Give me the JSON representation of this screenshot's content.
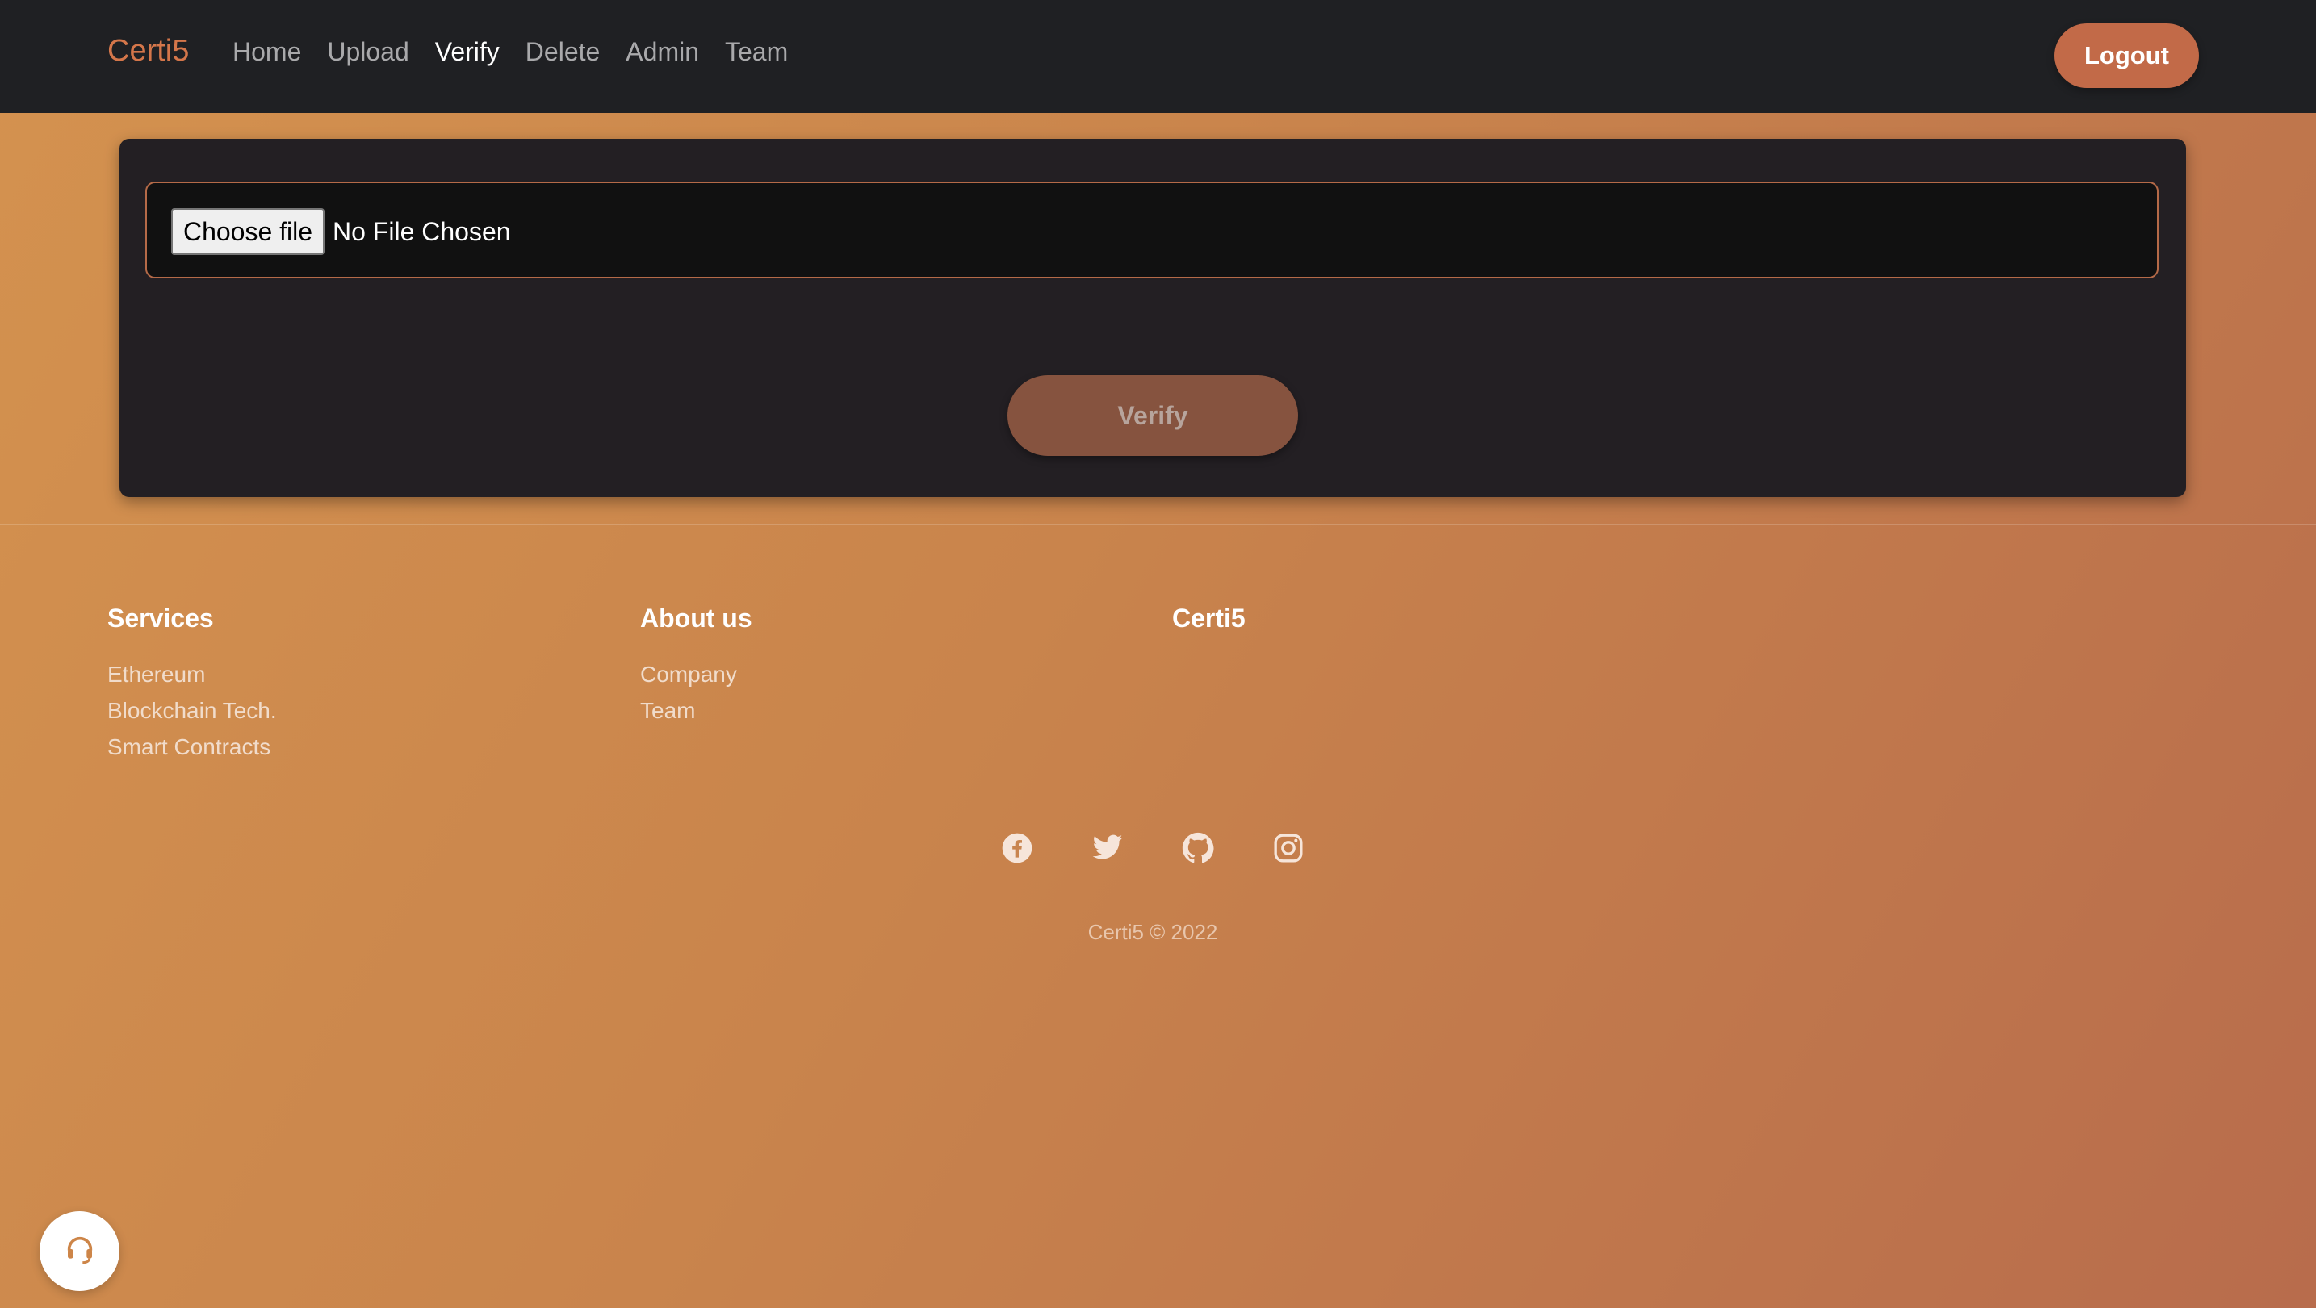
{
  "nav": {
    "brand": "Certi5",
    "links": [
      "Home",
      "Upload",
      "Verify",
      "Delete",
      "Admin",
      "Team"
    ],
    "active": "Verify",
    "logout_label": "Logout"
  },
  "verify_form": {
    "choose_file_label": "Choose file",
    "file_status": "No File Chosen",
    "verify_label": "Verify"
  },
  "footer": {
    "services_heading": "Services",
    "services_items": [
      "Ethereum",
      "Blockchain Tech.",
      "Smart Contracts"
    ],
    "about_heading": "About us",
    "about_items": [
      "Company",
      "Team"
    ],
    "brand_heading": "Certi5",
    "social_icons": [
      "facebook-icon",
      "twitter-icon",
      "github-icon",
      "instagram-icon"
    ],
    "copyright": "Certi5 © 2022"
  },
  "colors": {
    "accent": "#c26a48",
    "navbar_bg": "#1f2023",
    "card_bg": "#231f23"
  }
}
